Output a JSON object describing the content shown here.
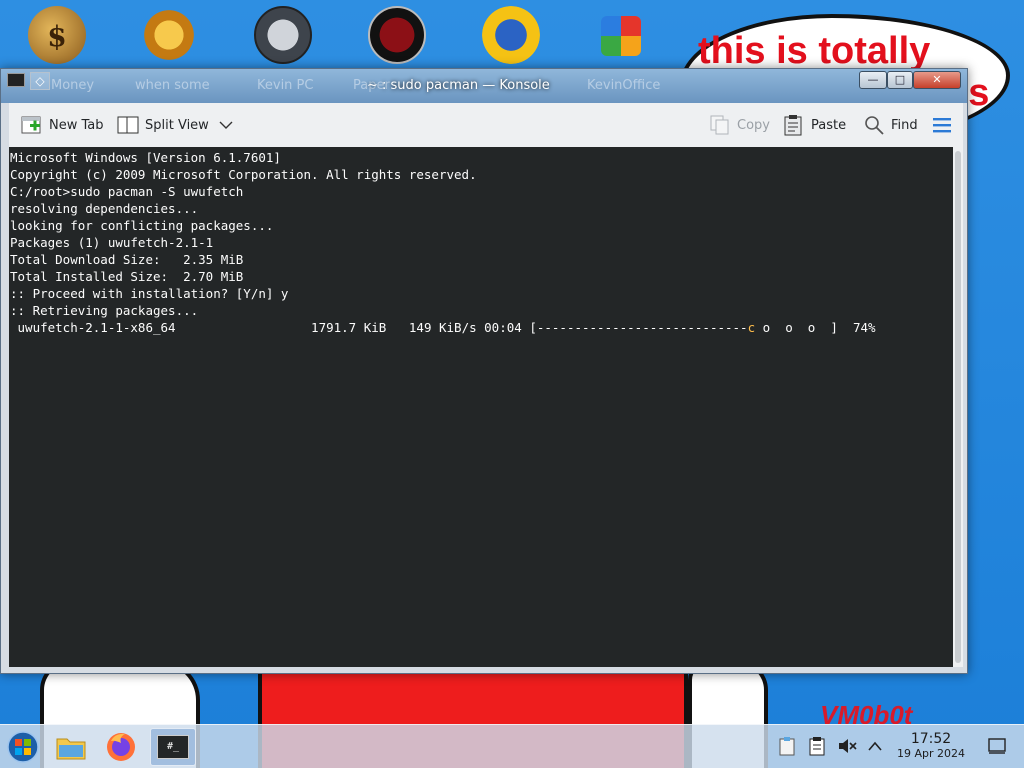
{
  "desktop": {
    "wallpaper_text": "this is totally windows 7 guys",
    "signature": "VM0b0t",
    "icons": [
      {
        "label": "Money",
        "icon": "money-bag-icon",
        "color": "#b8812c"
      },
      {
        "label": "when some",
        "icon": "gear-icon",
        "color": "#e49a1e"
      },
      {
        "label": "Kevin PC",
        "icon": "speedometer-icon",
        "color": "#707884"
      },
      {
        "label": "Paper",
        "icon": "paper-icon",
        "color": "#8c1016"
      },
      {
        "label": "",
        "icon": "sun-disc-icon",
        "color": "#f5c214"
      },
      {
        "label": "KevinOffice",
        "icon": "office-icon",
        "color": "#e0731c"
      }
    ]
  },
  "window": {
    "title": "~ : sudo pacman — Konsole",
    "title_ghost_labels": [
      "Money",
      "when some",
      "Kevin PC",
      "Paper",
      "KevinOffice"
    ],
    "buttons": {
      "minimize": "—",
      "maximize": "□",
      "close": "✕",
      "menu": "◇"
    },
    "toolbar": {
      "new_tab": "New Tab",
      "split_view": "Split View",
      "copy": "Copy",
      "paste": "Paste",
      "find": "Find"
    }
  },
  "terminal": {
    "lines": [
      "Microsoft Windows [Version 6.1.7601]",
      "Copyright (c) 2009 Microsoft Corporation. All rights reserved.",
      "",
      "C:/root>sudo pacman -S uwufetch",
      "resolving dependencies...",
      "looking for conflicting packages...",
      "",
      "Packages (1) uwufetch-2.1-1",
      "",
      "Total Download Size:   2.35 MiB",
      "Total Installed Size:  2.70 MiB",
      "",
      ":: Proceed with installation? [Y/n] y",
      ":: Retrieving packages..."
    ],
    "progress": {
      "package": " uwufetch-2.1-1-x86_64",
      "size": "1791.7 KiB",
      "rate": "149 KiB/s",
      "eta": "00:04",
      "bar_fill": "[----------------------------",
      "pacman": "c",
      "bar_rest": " o  o  o  ]",
      "percent": "74%"
    }
  },
  "taskbar": {
    "items": [
      "start-orb-icon",
      "folder-icon",
      "firefox-icon",
      "konsole-icon"
    ],
    "konsole_label": "#_",
    "clock_time": "17:52",
    "clock_date": "19 Apr 2024"
  }
}
